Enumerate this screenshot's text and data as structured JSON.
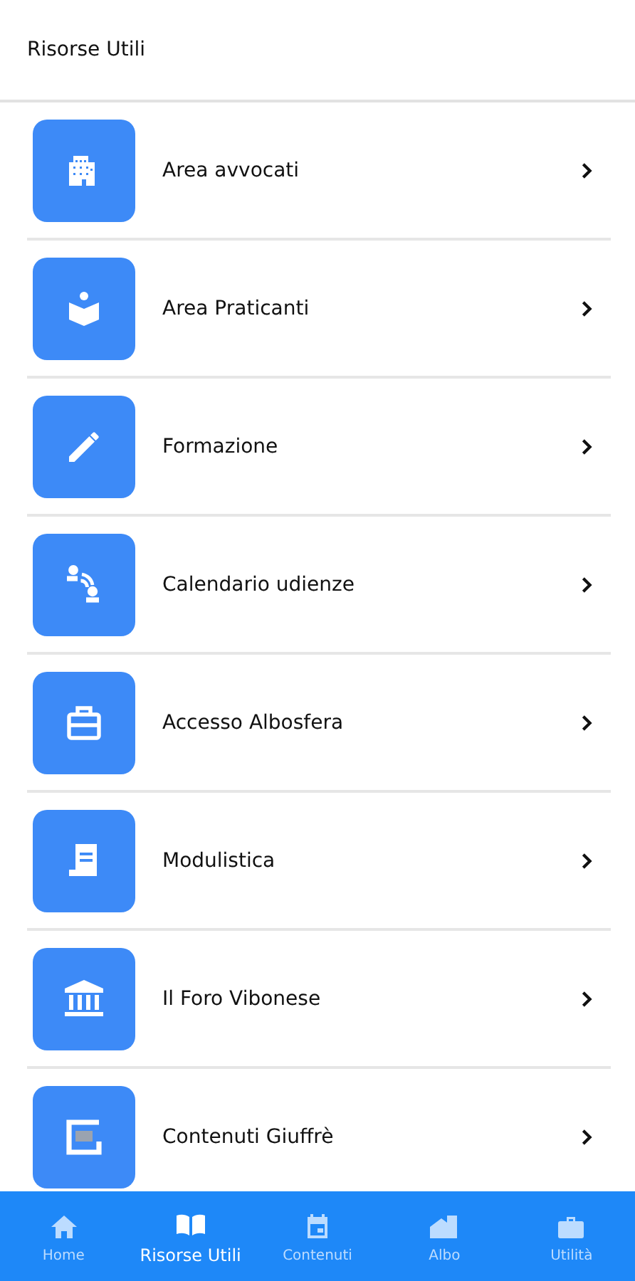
{
  "header": {
    "title": "Risorse Utili"
  },
  "items": [
    {
      "label": "Area avvocati"
    },
    {
      "label": "Area Praticanti"
    },
    {
      "label": "Formazione"
    },
    {
      "label": "Calendario udienze"
    },
    {
      "label": "Accesso Albosfera"
    },
    {
      "label": "Modulistica"
    },
    {
      "label": "Il Foro Vibonese"
    },
    {
      "label": "Contenuti Giuffrè"
    }
  ],
  "nav": [
    {
      "label": "Home",
      "selected": false
    },
    {
      "label": "Risorse Utili",
      "selected": true
    },
    {
      "label": "Contenuti",
      "selected": false
    },
    {
      "label": "Albo",
      "selected": false
    },
    {
      "label": "Utilità",
      "selected": false
    }
  ]
}
